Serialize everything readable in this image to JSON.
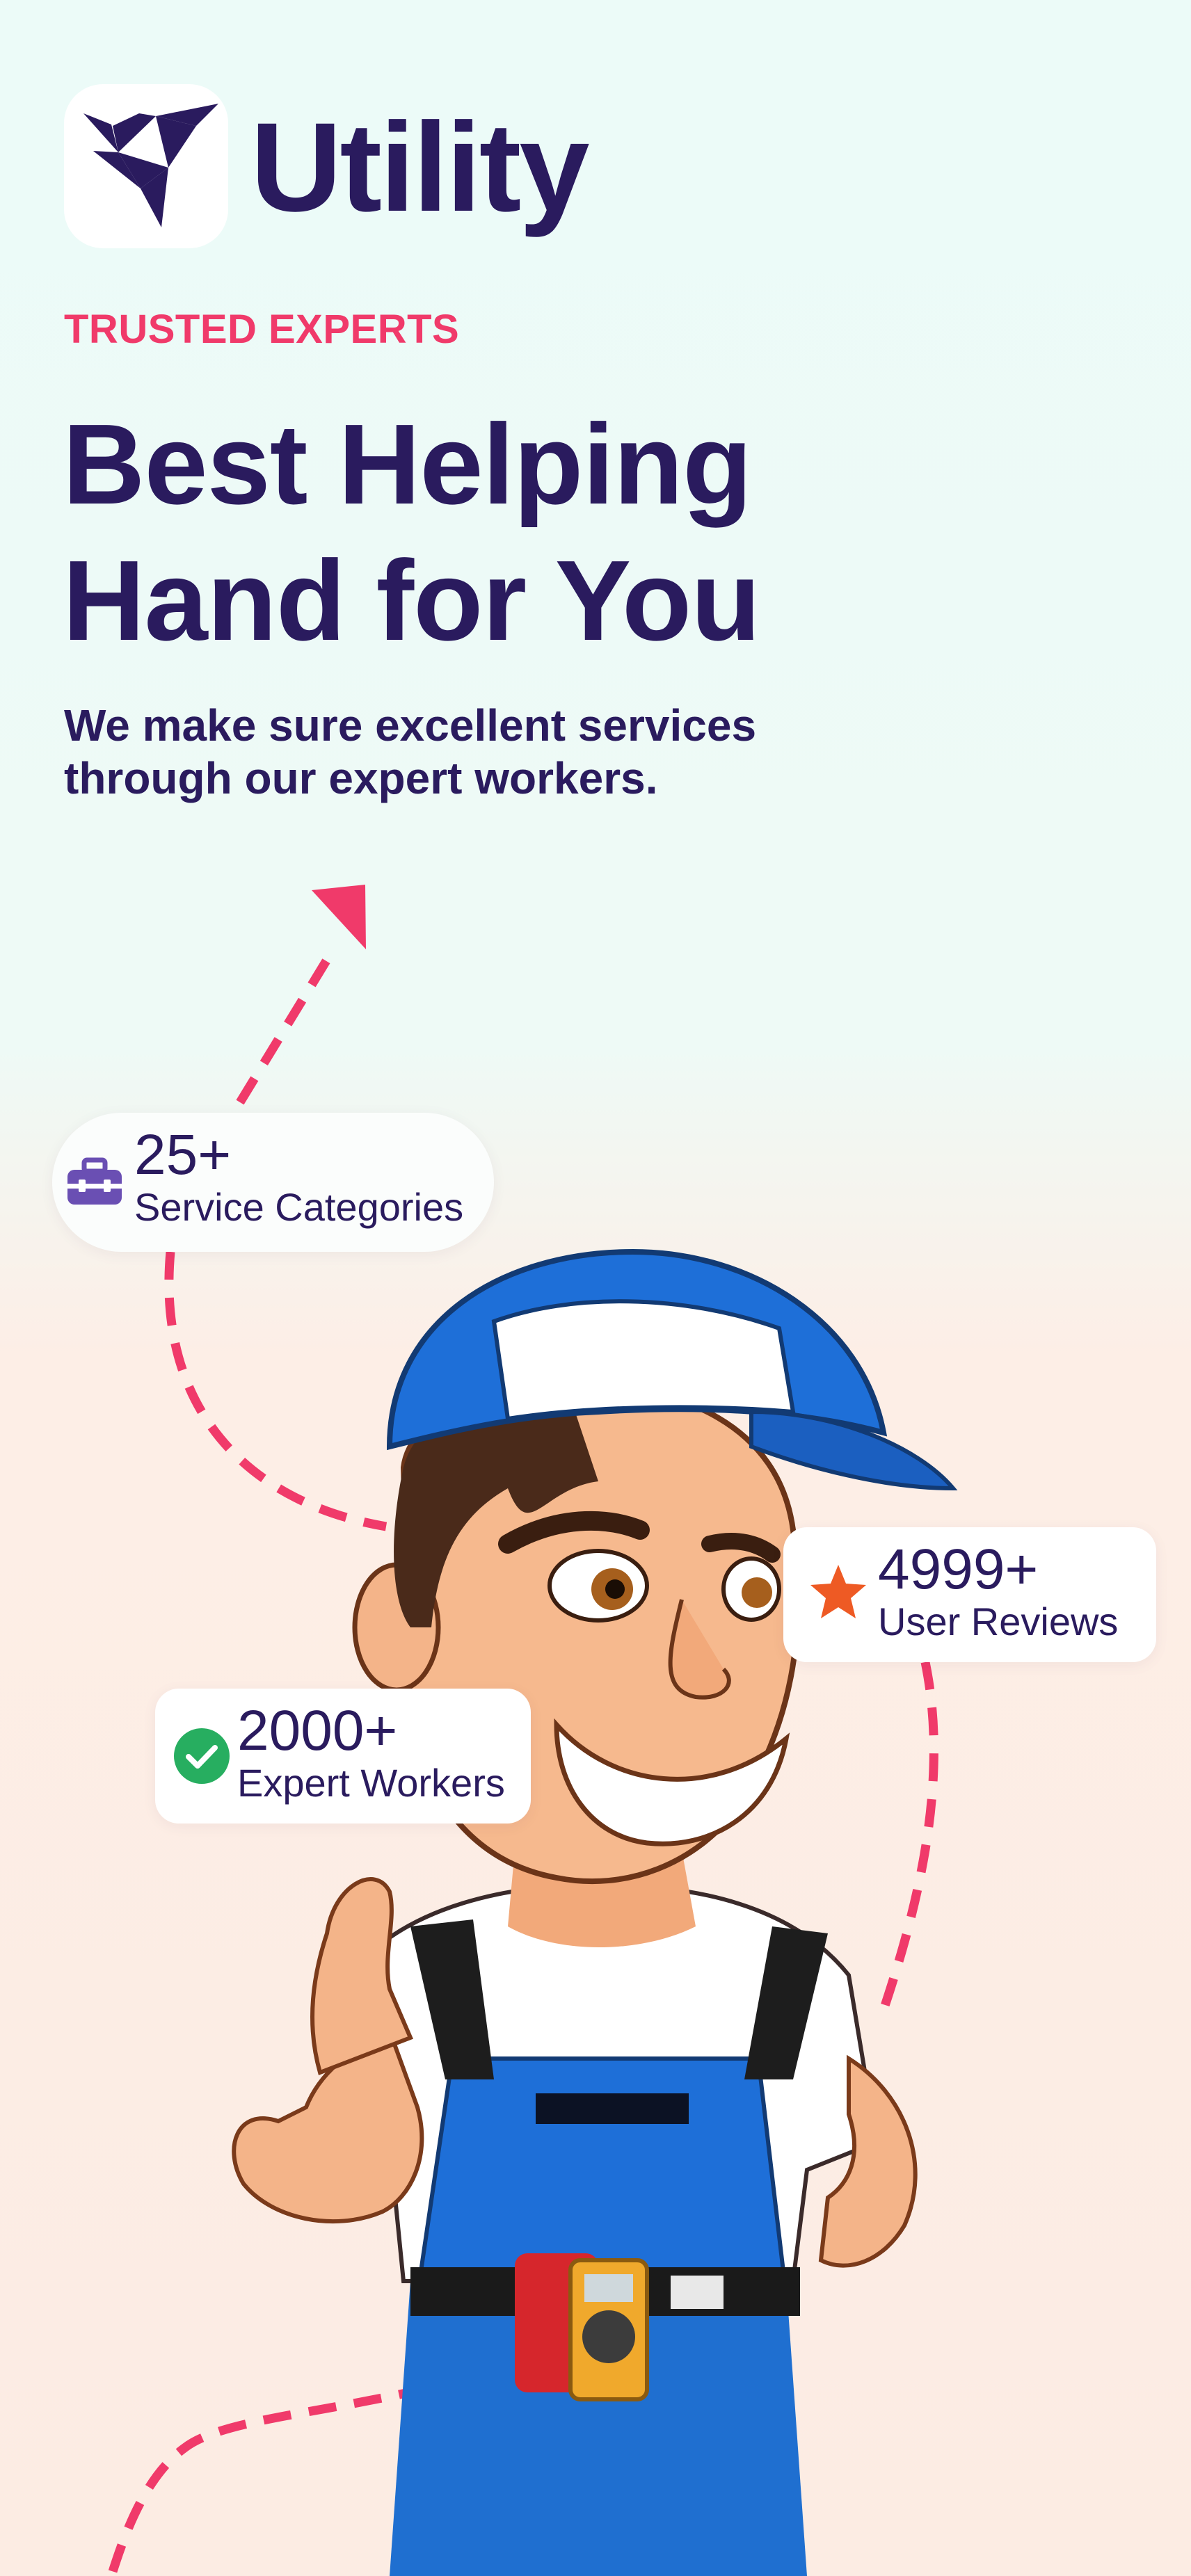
{
  "brand": {
    "name": "Utility",
    "logo_icon": "origami-bird-icon",
    "color": "#2a1b5e"
  },
  "hero": {
    "eyebrow": "TRUSTED EXPERTS",
    "headline_line1": "Best Helping",
    "headline_line2": "Hand for You",
    "subtitle_line1": "We make sure excellent services",
    "subtitle_line2": "through our expert workers.",
    "accent_color": "#f03a6a"
  },
  "stats": {
    "services": {
      "value": "25+",
      "label": "Service Categories",
      "icon": "toolbox-icon",
      "icon_color": "#6a4fb3"
    },
    "reviews": {
      "value": "4999+",
      "label": "User Reviews",
      "icon": "star-icon",
      "icon_color": "#ee5a24"
    },
    "workers": {
      "value": "2000+",
      "label": "Expert Workers",
      "icon": "check-circle-icon",
      "icon_color": "#27ae60"
    }
  },
  "illustration": {
    "name": "handyman-mascot-thumbs-up"
  }
}
